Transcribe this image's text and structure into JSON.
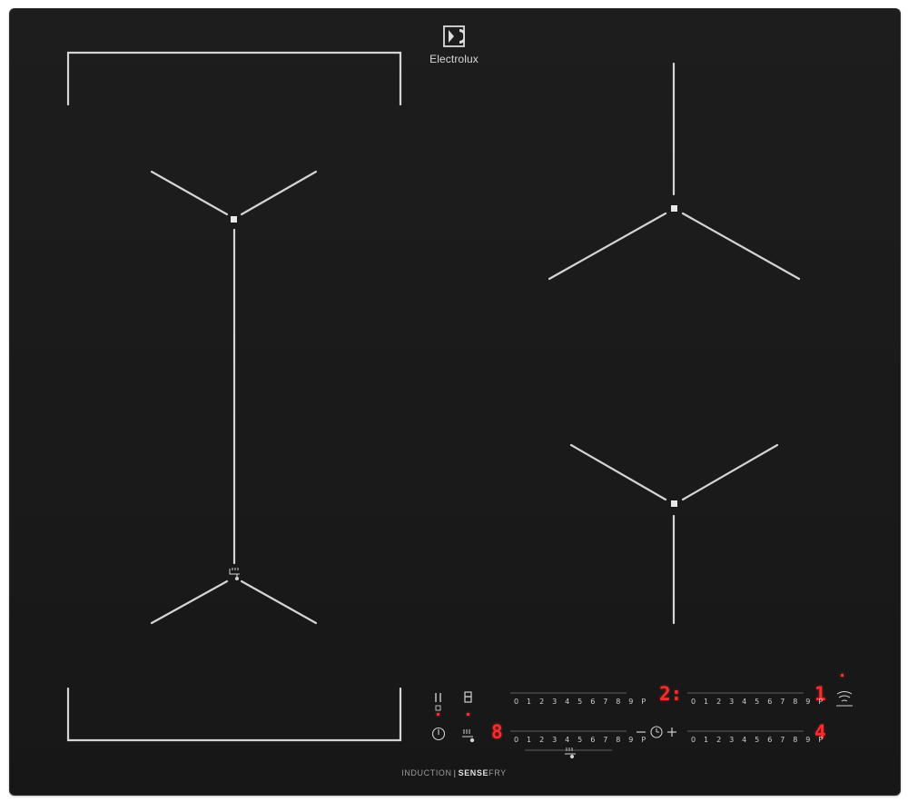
{
  "brand": {
    "name": "Electrolux",
    "icon": "electrolux-logo-icon"
  },
  "tagline": {
    "left": "INDUCTION",
    "separator": "|",
    "right_bold": "SENSE",
    "right": "FRY"
  },
  "zones": {
    "front_left_display": "8",
    "rear_right_display": "2:",
    "rear_right_level": "1",
    "front_right_display": "4"
  },
  "slider_labels": "0 1 2 3 4 5 6 7 8 9 P",
  "controls": {
    "pause_icon": "pause-icon",
    "lock_icon": "lock-icon",
    "power_icon": "power-icon",
    "sensefry_icon": "sensefry-icon",
    "timer_icon": "timer-icon",
    "wifi_icon": "wifi-icon",
    "timer_minus": "−",
    "timer_plus": "+"
  },
  "colors": {
    "surface": "#1a1a1a",
    "markings": "#d8d8d8",
    "display_red": "#ff2b2b"
  }
}
